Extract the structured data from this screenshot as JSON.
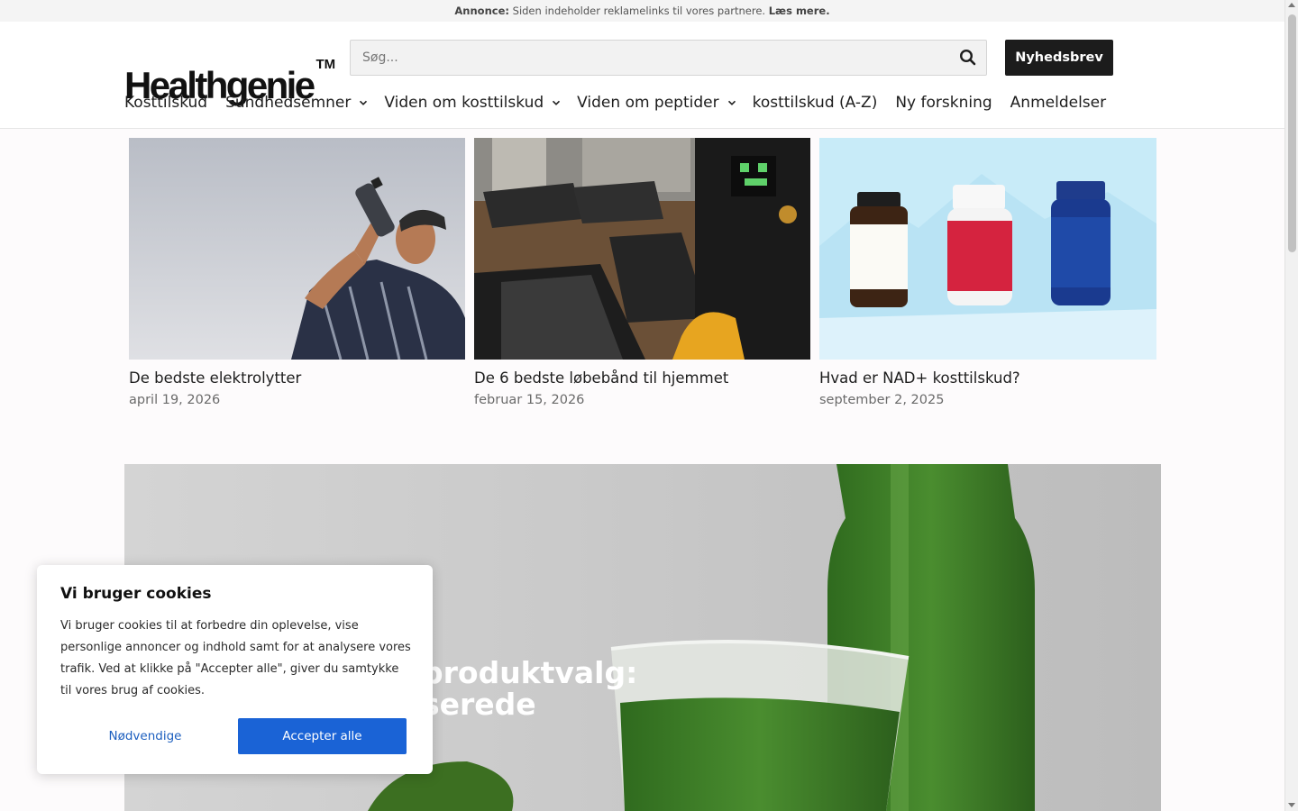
{
  "ad_bar": {
    "label": "Annonce:",
    "text": "Siden indeholder reklamelinks til vores partnere.",
    "link": "Læs mere."
  },
  "header": {
    "logo_text": "Healthgenie",
    "logo_tm": "TM",
    "search_placeholder": "Søg...",
    "search_icon": "search-icon",
    "newsletter_label": "Nyhedsbrev"
  },
  "nav": {
    "items": [
      {
        "label": "Kosttilskud",
        "has_dropdown": false
      },
      {
        "label": "Sundhedsemner",
        "has_dropdown": true
      },
      {
        "label": "Viden om kosttilskud",
        "has_dropdown": true
      },
      {
        "label": "Viden om peptider",
        "has_dropdown": true
      },
      {
        "label": "kosttilskud (A-Z)",
        "has_dropdown": false
      },
      {
        "label": "Ny forskning",
        "has_dropdown": false
      },
      {
        "label": "Anmeldelser",
        "has_dropdown": false
      }
    ]
  },
  "cards": [
    {
      "title": "De bedste elektrolytter",
      "date": "april 19, 2026"
    },
    {
      "title": "De 6 bedste løbebånd til hjemmet",
      "date": "februar 15, 2026"
    },
    {
      "title": "Hvad er NAD+ kosttilskud?",
      "date": "september 2, 2025"
    }
  ],
  "hero": {
    "title_line1": "produktvalg:",
    "title_line2": "serede"
  },
  "cookie": {
    "title": "Vi bruger cookies",
    "body": "Vi bruger cookies til at forbedre din oplevelse, vise personlige annoncer og indhold samt for at analysere vores trafik. Ved at klikke på \"Accepter alle\", giver du samtykke til vores brug af cookies.",
    "necessary_label": "Nødvendige",
    "accept_label": "Accepter alle"
  },
  "colors": {
    "accent": "#1a63d6",
    "dark": "#1c1c1c"
  }
}
